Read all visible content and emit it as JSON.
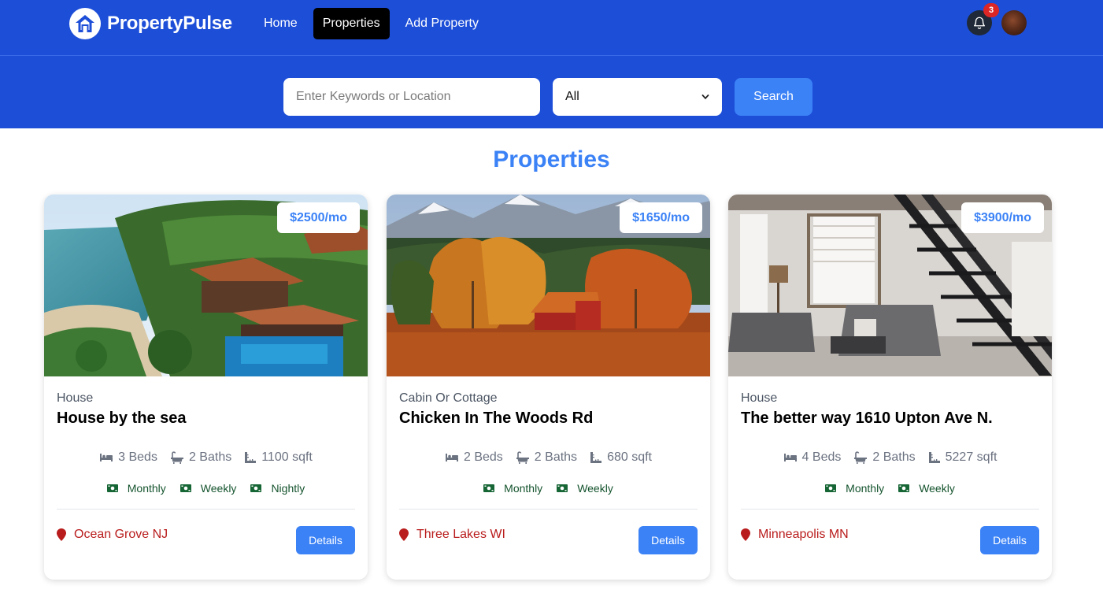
{
  "nav": {
    "brand": "PropertyPulse",
    "links": [
      {
        "label": "Home",
        "active": false
      },
      {
        "label": "Properties",
        "active": true
      },
      {
        "label": "Add Property",
        "active": false
      }
    ],
    "notification_count": "3"
  },
  "search": {
    "placeholder": "Enter Keywords or Location",
    "type_value": "All",
    "button_label": "Search"
  },
  "page_title": "Properties",
  "properties": [
    {
      "price": "$2500/mo",
      "type": "House",
      "name": "House by the sea",
      "beds": "3 Beds",
      "baths": "2 Baths",
      "sqft": "1100 sqft",
      "rates": [
        "Monthly",
        "Weekly",
        "Nightly"
      ],
      "location": "Ocean Grove NJ",
      "details_label": "Details"
    },
    {
      "price": "$1650/mo",
      "type": "Cabin Or Cottage",
      "name": "Chicken In The Woods Rd",
      "beds": "2 Beds",
      "baths": "2 Baths",
      "sqft": "680 sqft",
      "rates": [
        "Monthly",
        "Weekly"
      ],
      "location": "Three Lakes WI",
      "details_label": "Details"
    },
    {
      "price": "$3900/mo",
      "type": "House",
      "name": "The better way 1610 Upton Ave N.",
      "beds": "4 Beds",
      "baths": "2 Baths",
      "sqft": "5227 sqft",
      "rates": [
        "Monthly",
        "Weekly"
      ],
      "location": "Minneapolis MN",
      "details_label": "Details"
    }
  ],
  "icons": {
    "logo": "house-icon",
    "notifications": "bell-icon",
    "beds": "bed-icon",
    "baths": "bath-icon",
    "sqft": "ruler-icon",
    "rate": "money-bill-icon",
    "location": "map-marker-icon",
    "select": "chevron-down-icon"
  },
  "colors": {
    "nav_bg": "#1d4ed8",
    "accent": "#3b82f6",
    "location": "#b91c1c",
    "rates": "#14532d",
    "badge": "#dc2626"
  }
}
